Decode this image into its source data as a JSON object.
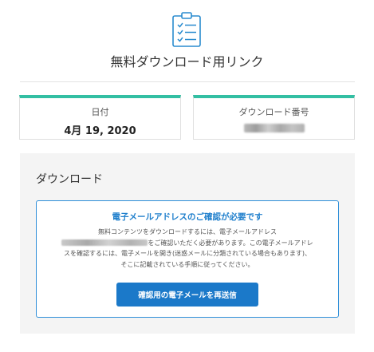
{
  "header": {
    "icon": "clipboard-checklist-icon",
    "title": "無料ダウンロード用リンク"
  },
  "info": {
    "date_label": "日付",
    "date_value": "4月 19, 2020",
    "order_label": "ダウンロード番号"
  },
  "download": {
    "title": "ダウンロード",
    "notice": {
      "heading": "電子メールアドレスのご確認が必要です",
      "line1": "無料コンテンツをダウンロードするには、電子メールアドレス",
      "line2_suffix": "をご確認いただく必要があります。この電子メールアドレ",
      "line3": "スを確認するには、電子メールを開き(迷惑メールに分類されている場合もあります)、",
      "line4": "そこに記載されている手順に従ってください。"
    },
    "resend_label": "確認用の電子メールを再送信"
  },
  "colors": {
    "accent_teal": "#33bfa3",
    "link_blue": "#1f7fcc",
    "button_blue": "#1b79c9",
    "icon_blue": "#2a8ccf"
  }
}
